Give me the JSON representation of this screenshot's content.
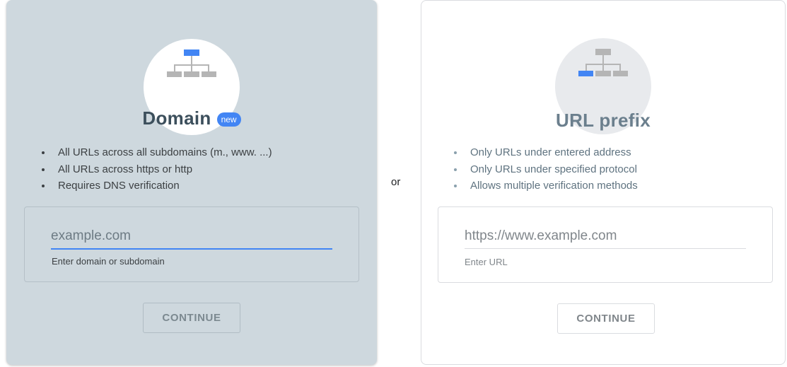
{
  "domain_card": {
    "title": "Domain",
    "badge": "new",
    "features": [
      "All URLs across all subdomains (m., www. ...)",
      "All URLs across https or http",
      "Requires DNS verification"
    ],
    "input_placeholder": "example.com",
    "input_value": "",
    "helper_text": "Enter domain or subdomain",
    "button_label": "CONTINUE",
    "icon": "sitemap-icon",
    "background_color": "#ced8de",
    "accent_color": "#4285f4"
  },
  "separator": "or",
  "url_prefix_card": {
    "title": "URL prefix",
    "features": [
      "Only URLs under entered address",
      "Only URLs under specified protocol",
      "Allows multiple verification methods"
    ],
    "input_placeholder": "https://www.example.com",
    "input_value": "",
    "helper_text": "Enter URL",
    "button_label": "CONTINUE",
    "icon": "sitemap-icon",
    "background_color": "#ffffff",
    "accent_color": "#4285f4"
  }
}
